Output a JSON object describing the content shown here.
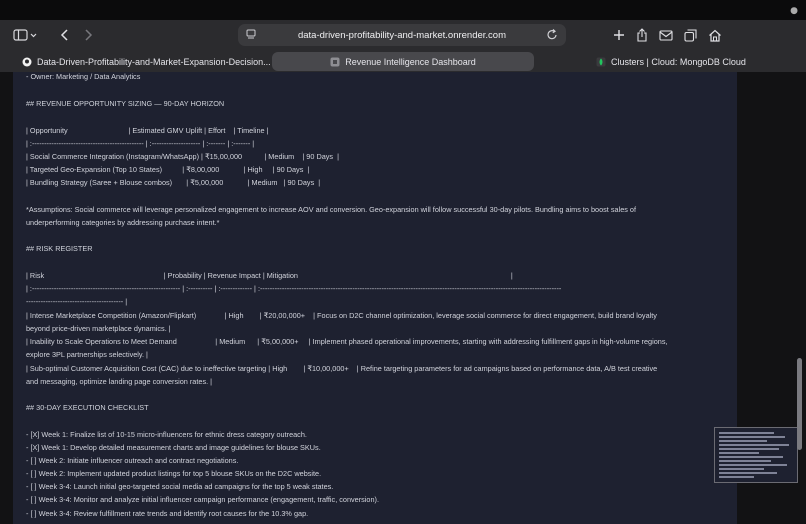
{
  "browser": {
    "address_text": "data-driven-profitability-and-market.onrender.com",
    "tabs": [
      {
        "label": "Data-Driven-Profitability-and-Market-Expansion-Decision...",
        "icon": "github-icon"
      },
      {
        "label": "Revenue Intelligence Dashboard",
        "icon": "page-icon"
      },
      {
        "label": "Clusters | Cloud: MongoDB Cloud",
        "icon": "mongodb-leaf-icon"
      }
    ]
  },
  "document": {
    "lines": [
      "- Owner: Marketing / Data Analytics",
      "## REVENUE OPPORTUNITY SIZING — 90-DAY HORIZON",
      "| Opportunity                              | Estimated GMV Uplift | Effort    | Timeline |",
      "| :---------------------------------------------- | :-------------------- | :------- | :------- |",
      "| Social Commerce Integration (Instagram/WhatsApp) | ₹15,00,000           | Medium    | 90 Days  |",
      "| Targeted Geo-Expansion (Top 10 States)          | ₹8,00,000            | High     | 90 Days  |",
      "| Bundling Strategy (Saree + Blouse combos)       | ₹5,00,000            | Medium   | 90 Days  |",
      "*Assumptions: Social commerce will leverage personalized engagement to increase AOV and conversion. Geo-expansion will follow successful 30-day pilots. Bundling aims to boost sales of",
      "underperforming categories by addressing purchase intent.*",
      "## RISK REGISTER",
      "| Risk                                                           | Probability | Revenue Impact | Mitigation                                                                                                         |",
      "| :------------------------------------------------------------- | :---------- | :------------- | :----------------------------------------------------------------------------------------------------------------------------",
      "---------------------------------------- |",
      "| Intense Marketplace Competition (Amazon/Flipkart)              | High        | ₹20,00,000+    | Focus on D2C channel optimization, leverage social commerce for direct engagement, build brand loyalty",
      "beyond price-driven marketplace dynamics. |",
      "| Inability to Scale Operations to Meet Demand                   | Medium      | ₹5,00,000+     | Implement phased operational improvements, starting with addressing fulfillment gaps in high-volume regions,",
      "explore 3PL partnerships selectively. |",
      "| Sub-optimal Customer Acquisition Cost (CAC) due to ineffective targeting | High        | ₹10,00,000+    | Refine targeting parameters for ad campaigns based on performance data, A/B test creative",
      "and messaging, optimize landing page conversion rates. |",
      "## 30-DAY EXECUTION CHECKLIST",
      "- [X] Week 1: Finalize list of 10-15 micro-influencers for ethnic dress category outreach.",
      "- [X] Week 1: Develop detailed measurement charts and image guidelines for blouse SKUs.",
      "- [ ] Week 2: Initiate influencer outreach and contract negotiations.",
      "- [ ] Week 2: Implement updated product listings for top 5 blouse SKUs on the D2C website.",
      "- [ ] Week 3-4: Launch initial geo-targeted social media ad campaigns for the top 5 weak states.",
      "- [ ] Week 3-4: Monitor and analyze initial influencer campaign performance (engagement, traffic, conversion).",
      "- [ ] Week 3-4: Review fulfillment rate trends and identify root causes for the 10.3% gap."
    ]
  }
}
